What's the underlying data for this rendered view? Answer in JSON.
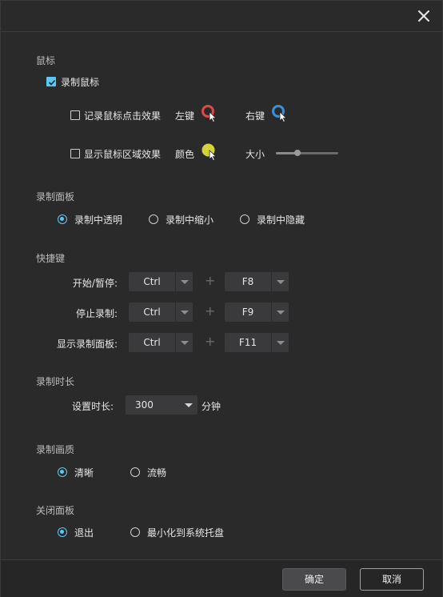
{
  "colors": {
    "accent": "#5ac8f5",
    "left_click": "#e04848",
    "right_click": "#3a8fd8",
    "highlight": "#d8d23a"
  },
  "mouse": {
    "title": "鼠标",
    "record_mouse": {
      "label": "录制鼠标",
      "checked": true
    },
    "click_effect": {
      "label": "记录鼠标点击效果",
      "checked": false,
      "left_label": "左键",
      "right_label": "右键"
    },
    "area_effect": {
      "label": "显示鼠标区域效果",
      "checked": false,
      "color_label": "颜色",
      "size_label": "大小",
      "size_value": 0.35
    }
  },
  "panel": {
    "title": "录制面板",
    "options": [
      {
        "label": "录制中透明",
        "checked": true
      },
      {
        "label": "录制中缩小",
        "checked": false
      },
      {
        "label": "录制中隐藏",
        "checked": false
      }
    ]
  },
  "hotkeys": {
    "title": "快捷键",
    "rows": [
      {
        "label": "开始/暂停:",
        "modifier": "Ctrl",
        "key": "F8"
      },
      {
        "label": "停止录制:",
        "modifier": "Ctrl",
        "key": "F9"
      },
      {
        "label": "显示录制面板:",
        "modifier": "Ctrl",
        "key": "F11"
      }
    ],
    "plus": "+"
  },
  "duration": {
    "title": "录制时长",
    "label": "设置时长:",
    "value": "300",
    "unit": "分钟"
  },
  "quality": {
    "title": "录制画质",
    "options": [
      {
        "label": "清晰",
        "checked": true
      },
      {
        "label": "流畅",
        "checked": false
      }
    ]
  },
  "close_panel": {
    "title": "关闭面板",
    "options": [
      {
        "label": "退出",
        "checked": true
      },
      {
        "label": "最小化到系统托盘",
        "checked": false
      }
    ]
  },
  "footer": {
    "ok_label": "确定",
    "cancel_label": "取消"
  }
}
